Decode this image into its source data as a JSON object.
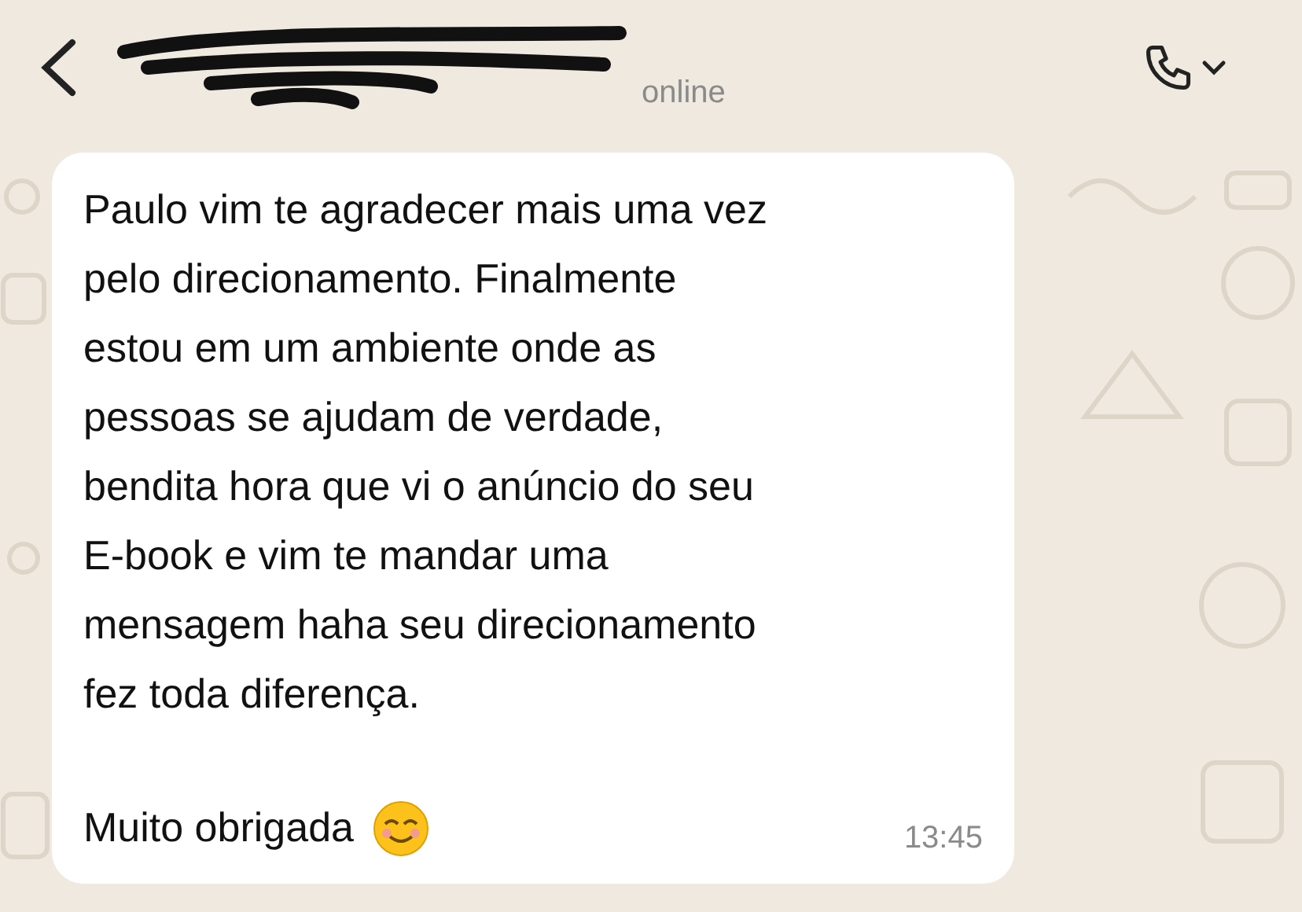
{
  "header": {
    "status": "online"
  },
  "message": {
    "text": "Paulo vim te agradecer mais uma vez\npelo direcionamento. Finalmente\nestou em um ambiente onde as\npessoas se ajudam de verdade,\nbendita hora que vi o anúncio do seu\nE-book e vim te mandar uma\nmensagem haha seu direcionamento\nfez toda diferença.",
    "closing": "Muito obrigada",
    "time": "13:45"
  }
}
